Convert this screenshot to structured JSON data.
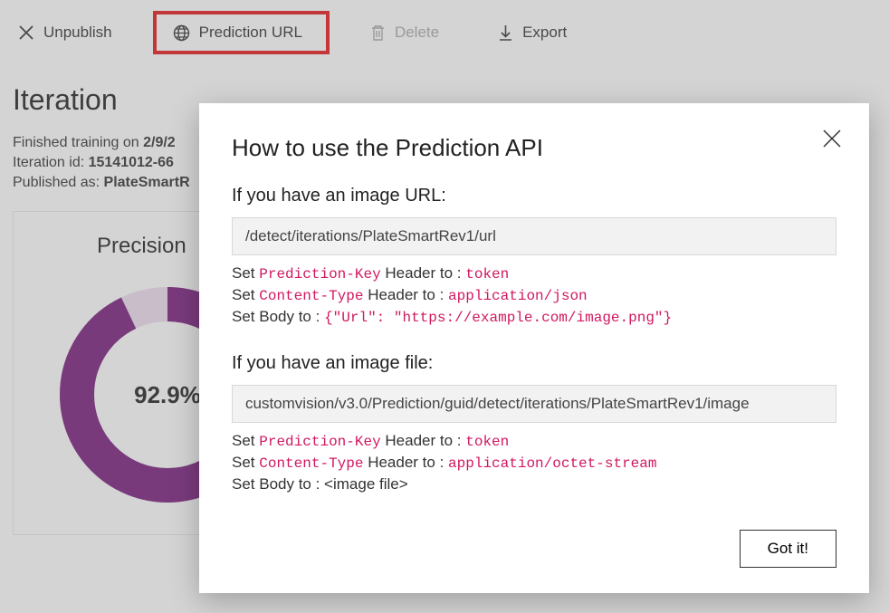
{
  "toolbar": {
    "unpublish": "Unpublish",
    "prediction_url": "Prediction URL",
    "delete": "Delete",
    "export": "Export"
  },
  "page": {
    "title": "Iteration",
    "finished_prefix": "Finished training on ",
    "finished_value": "2/9/2",
    "iteration_id_prefix": "Iteration id: ",
    "iteration_id_value": "15141012-66",
    "published_prefix": "Published as: ",
    "published_value": "PlateSmartR"
  },
  "metric": {
    "title": "Precision",
    "value": 92.9,
    "display": "92.9%"
  },
  "modal": {
    "title": "How to use the Prediction API",
    "url_section": {
      "heading": "If you have an image URL:",
      "endpoint": "/detect/iterations/PlateSmartRev1/url",
      "line1_prefix": "Set ",
      "line1_code1": "Prediction-Key",
      "line1_mid": " Header to : ",
      "line1_code2": "token",
      "line2_prefix": "Set ",
      "line2_code1": "Content-Type",
      "line2_mid": " Header to : ",
      "line2_code2": "application/json",
      "line3_prefix": "Set Body to : ",
      "line3_code": "{\"Url\": \"https://example.com/image.png\"}"
    },
    "file_section": {
      "heading": "If you have an image file:",
      "endpoint": "customvision/v3.0/Prediction/guid/detect/iterations/PlateSmartRev1/image",
      "line1_prefix": "Set ",
      "line1_code1": "Prediction-Key",
      "line1_mid": " Header to : ",
      "line1_code2": "token",
      "line2_prefix": "Set ",
      "line2_code1": "Content-Type",
      "line2_mid": " Header to : ",
      "line2_code2": "application/octet-stream",
      "line3": "Set Body to : <image file>"
    },
    "got_it": "Got it!"
  }
}
